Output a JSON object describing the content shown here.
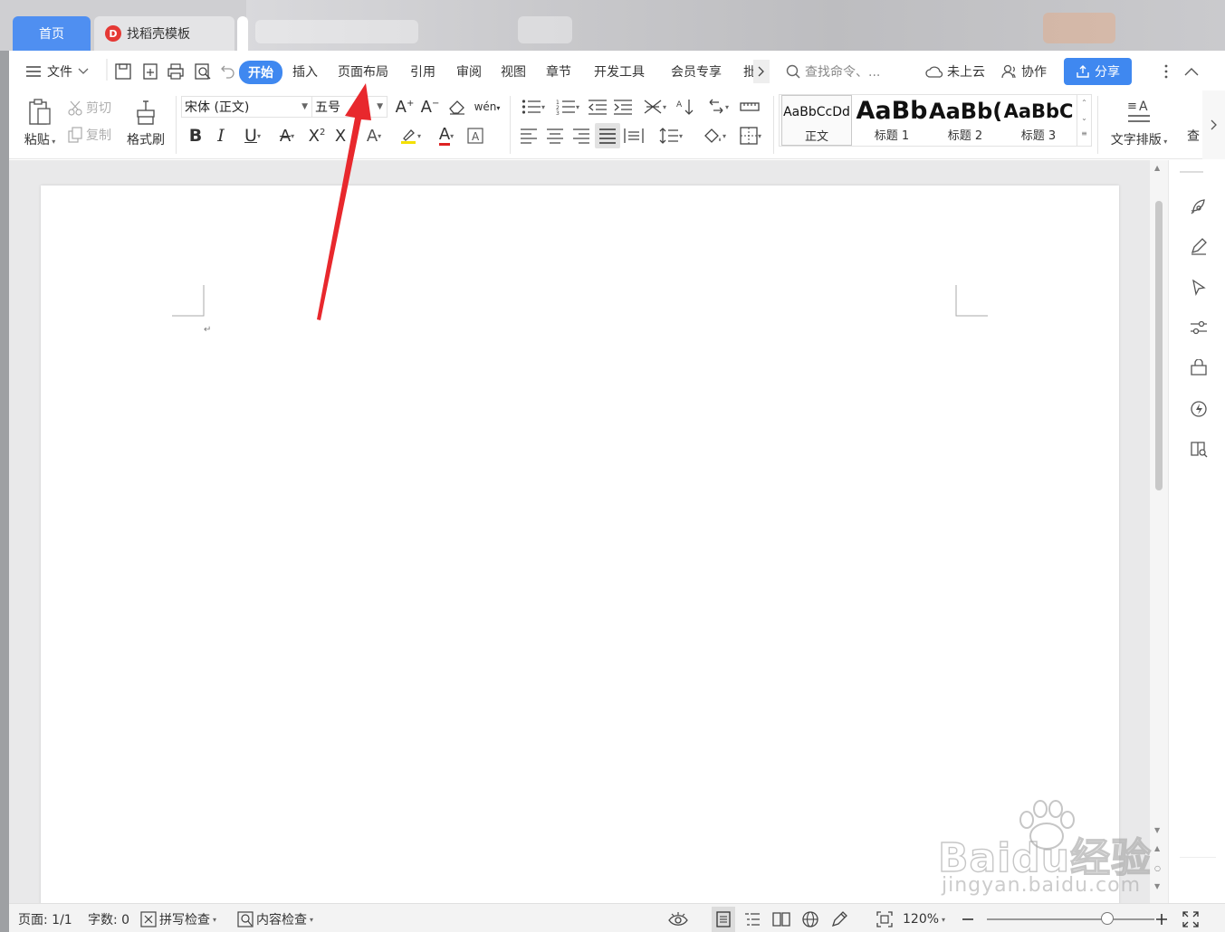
{
  "tabs": {
    "home": "首页",
    "template": "找稻壳模板"
  },
  "menu": {
    "file": "文件",
    "items": [
      "开始",
      "插入",
      "页面布局",
      "引用",
      "审阅",
      "视图",
      "章节",
      "开发工具",
      "会员专享",
      "批"
    ],
    "search_placeholder": "查找命令、...",
    "cloud": "未上云",
    "collab": "协作",
    "share": "分享"
  },
  "ribbon": {
    "paste": "粘贴",
    "cut": "剪切",
    "copy": "复制",
    "format_painter": "格式刷",
    "font_name": "宋体 (正文)",
    "font_size": "五号",
    "text_layout": "文字排版",
    "more": "查",
    "styles": [
      {
        "preview": "AaBbCcDd",
        "label": "正文"
      },
      {
        "preview": "AaBb",
        "label": "标题 1"
      },
      {
        "preview": "AaBb(",
        "label": "标题 2"
      },
      {
        "preview": "AaBbC",
        "label": "标题 3"
      }
    ]
  },
  "document": {
    "paragraph_mark": "↵"
  },
  "status": {
    "page": "页面: 1/1",
    "words": "字数: 0",
    "spell": "拼写检查",
    "content_check": "内容检查",
    "zoom": "120%",
    "zoom_level": 0.72
  },
  "watermark": {
    "brand": "Baidu经验",
    "url": "jingyan.baidu.com"
  },
  "colors": {
    "accent": "#3f88f0",
    "annotation": "#e8282d"
  }
}
